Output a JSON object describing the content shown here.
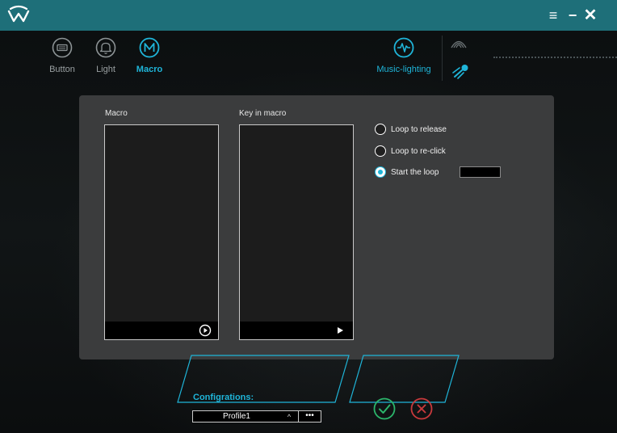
{
  "titlebar": {
    "accent": "#1e6f79",
    "icons": {
      "logo": "app-logo-icon",
      "menu": "hamburger-icon",
      "minimize": "minimize-icon",
      "close": "close-icon"
    },
    "menu_glyph": "≡",
    "minimize_glyph": "−",
    "close_glyph": "✕"
  },
  "nav": {
    "tabs": [
      {
        "label": "Button",
        "icon": "keyboard-icon",
        "active": false
      },
      {
        "label": "Light",
        "icon": "bell-icon",
        "active": false
      },
      {
        "label": "Macro",
        "icon": "macro-m-icon",
        "active": true
      }
    ],
    "music": {
      "label": "Music-lighting",
      "icon": "pulse-icon"
    },
    "extra_icons": [
      "wireless-signal-icon",
      "comet-icon"
    ]
  },
  "macro": {
    "macro_title": "Macro",
    "keys_title": "Key in macro",
    "options": [
      {
        "label": "Loop to release",
        "selected": false
      },
      {
        "label": "Loop to re-click",
        "selected": false
      },
      {
        "label": "Start the loop",
        "selected": true
      }
    ],
    "loop_count": ""
  },
  "footer": {
    "configurations_label": "Configrations:",
    "profile": "Profile1",
    "caret": "^",
    "more": "•••",
    "confirm_icon": "check-circle-icon",
    "cancel_icon": "x-circle-icon"
  },
  "colors": {
    "accent": "#1fb5d9",
    "confirm": "#2bb56b",
    "cancel": "#c8393c",
    "panel": "#3b3c3d"
  }
}
